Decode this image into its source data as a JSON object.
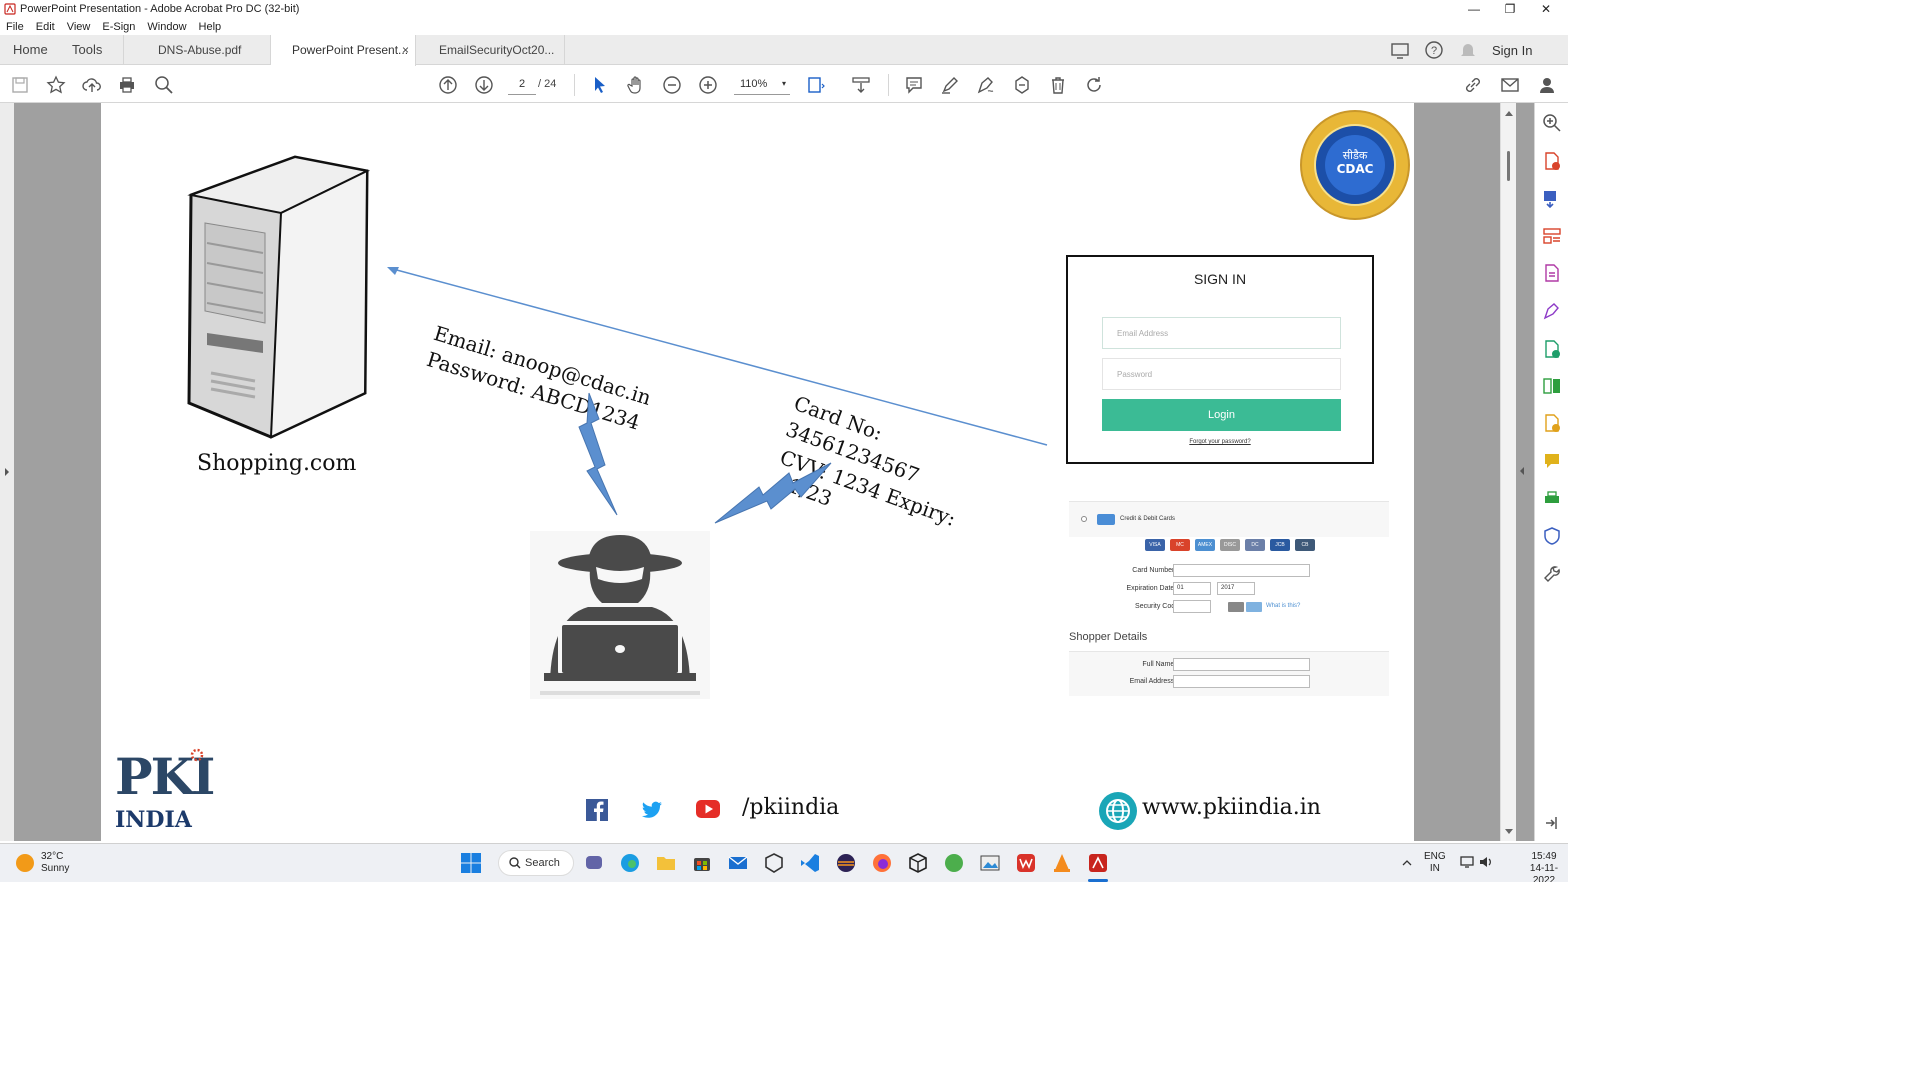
{
  "window": {
    "title": "PowerPoint Presentation - Adobe Acrobat Pro DC (32-bit)",
    "minimize": "—",
    "maximize": "❐",
    "close": "✕"
  },
  "menu": [
    "File",
    "Edit",
    "View",
    "E-Sign",
    "Window",
    "Help"
  ],
  "tabs": {
    "home": "Home",
    "tools": "Tools",
    "doc1": "DNS-Abuse.pdf",
    "doc2": "PowerPoint Present...",
    "doc3": "EmailSecurityOct20...",
    "close": "×"
  },
  "header_right": {
    "sign_in": "Sign In"
  },
  "toolbar": {
    "page_current": "2",
    "page_total": "/  24",
    "zoom": "110%",
    "zoom_arrow": "▾"
  },
  "slide": {
    "server_label": "Shopping.com",
    "email_text": "Email: anoop@cdac.in",
    "password_text": "Password: ABCD1234",
    "card_line1": "Card No:",
    "card_line2": "34561234567",
    "card_line3": "CVV: 1234 Expiry:",
    "card_line4": "1/23",
    "signin": {
      "title": "SIGN IN",
      "email_placeholder": "Email Address",
      "password_placeholder": "Password",
      "login": "Login",
      "forgot": "Forgot your password?"
    },
    "cardform": {
      "header": "Credit & Debit Cards",
      "card_number": "Card Number",
      "expiration": "Expiration Date",
      "month": "01",
      "year": "2017",
      "security": "Security Code",
      "what": "What is this?",
      "shopper": "Shopper Details",
      "full_name": "Full Name",
      "email": "Email Address",
      "required": "*",
      "cards": [
        "VISA",
        "MC",
        "AMEX",
        "DISC",
        "DC",
        "JCB",
        "CB"
      ]
    },
    "logo_pki": "PKI",
    "logo_india": "INDIA",
    "social_handle": "/pkiindia",
    "website": "www.pkiindia.in",
    "cdac_text": "सीडैक",
    "cdac_sub": "CDAC"
  },
  "taskbar": {
    "temp": "32°C",
    "weather": "Sunny",
    "search": "Search",
    "lang": "ENG",
    "region": "IN",
    "time": "15:49",
    "date": "14-11-2022"
  },
  "colors": {
    "acrobat_red": "#c8251e",
    "login_green": "#3bbb95",
    "arrow_blue": "#5b8fcf"
  }
}
